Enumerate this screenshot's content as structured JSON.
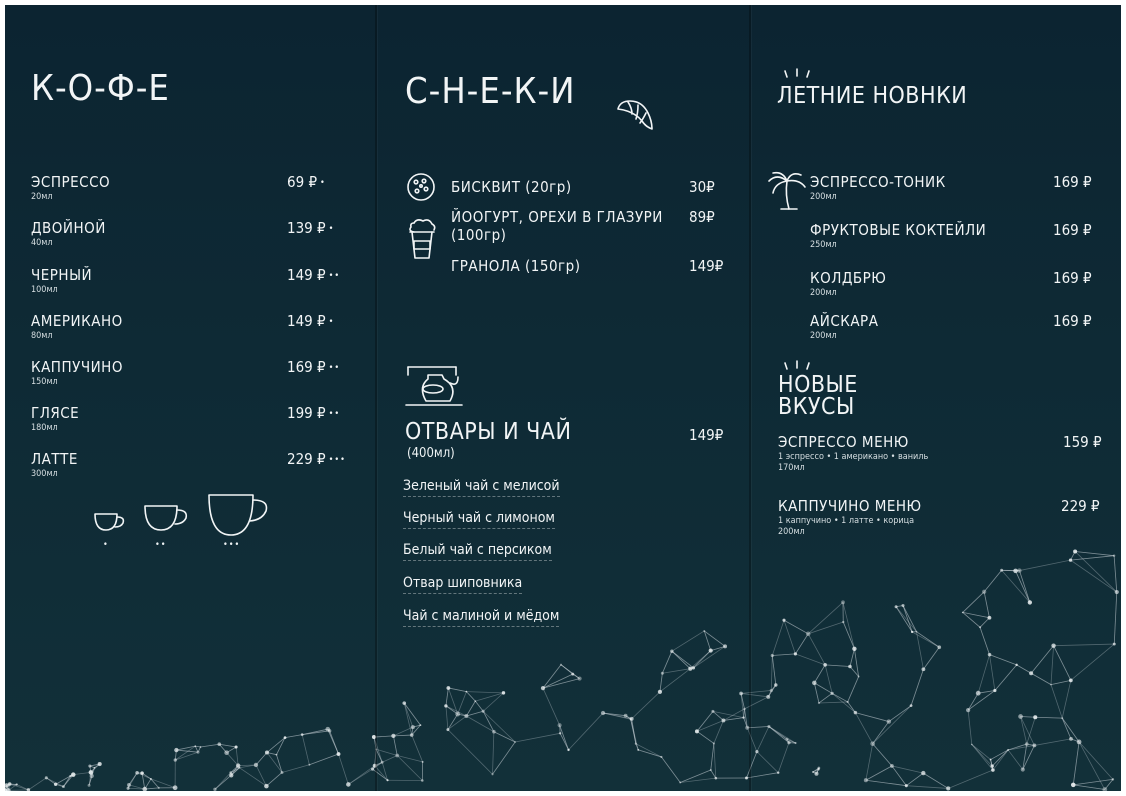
{
  "coffee": {
    "title": "К-О-Ф-Е",
    "items": [
      {
        "name": "ЭСПРЕССО",
        "volume": "20мл",
        "price": "69 ₽",
        "dots": "•"
      },
      {
        "name": "ДВОЙНОЙ",
        "volume": "40мл",
        "price": "139 ₽",
        "dots": "•"
      },
      {
        "name": "ЧЕРНЫЙ",
        "volume": "100мл",
        "price": "149 ₽",
        "dots": "••"
      },
      {
        "name": "АМЕРИКАНО",
        "volume": "80мл",
        "price": "149 ₽",
        "dots": "•"
      },
      {
        "name": "КАППУЧИНО",
        "volume": "150мл",
        "price": "169 ₽",
        "dots": "••"
      },
      {
        "name": "ГЛЯСЕ",
        "volume": "180мл",
        "price": "199 ₽",
        "dots": "••"
      },
      {
        "name": "ЛАТТЕ",
        "volume": "300мл",
        "price": "229 ₽",
        "dots": "•••"
      }
    ],
    "cup_sizes": [
      "•",
      "••",
      "•••"
    ]
  },
  "snacks": {
    "title": "С-Н-Е-К-И",
    "items": [
      {
        "name": "БИСКВИТ (20гр)",
        "price": "30₽",
        "icon": "cookie-icon"
      },
      {
        "name": "ЙООГУРТ, ОРЕХИ В ГЛАЗУРИ (100гр)",
        "name_line1": "ЙООГУРТ, ОРЕХИ В ГЛАЗУРИ",
        "name_line2": "(100гр)",
        "price": "89₽",
        "icon": "yogurt-cup-icon"
      },
      {
        "name": "ГРАНОЛА (150гр)",
        "price": "149₽"
      }
    ],
    "tea": {
      "title": "ОТВАРЫ И ЧАЙ",
      "volume": "(400мл)",
      "price": "149₽",
      "icon": "teapot-icon",
      "items": [
        "Зеленый чай с мелисой",
        "Черный чай с лимоном",
        "Белый чай с персиком",
        "Отвар шиповника",
        "Чай с малиной и мёдом"
      ]
    }
  },
  "summer": {
    "title": "ЛЕТНИЕ НОВНКИ",
    "items": [
      {
        "name": "ЭСПРЕССО-ТОНИК",
        "volume": "200мл",
        "price": "169 ₽",
        "icon": "palm-tree-icon"
      },
      {
        "name": "ФРУКТОВЫЕ КОКТЕЙЛИ",
        "volume": "250мл",
        "price": "169 ₽"
      },
      {
        "name": "КОЛДБРЮ",
        "volume": "200мл",
        "price": "169 ₽"
      },
      {
        "name": "АЙСКАРА",
        "volume": "200мл",
        "price": "169 ₽"
      }
    ],
    "new_title_line1": "НОВЫЕ",
    "new_title_line2": "ВКУСЫ",
    "new_items": [
      {
        "name": "ЭСПРЕССО МЕНЮ",
        "desc": "1 эспрессо • 1 американо • ваниль",
        "volume": "170мл",
        "price": "159 ₽"
      },
      {
        "name": "КАППУЧИНО МЕНЮ",
        "desc": "1 каппучино • 1 латте • корица",
        "volume": "200мл",
        "price": "229 ₽"
      }
    ]
  }
}
